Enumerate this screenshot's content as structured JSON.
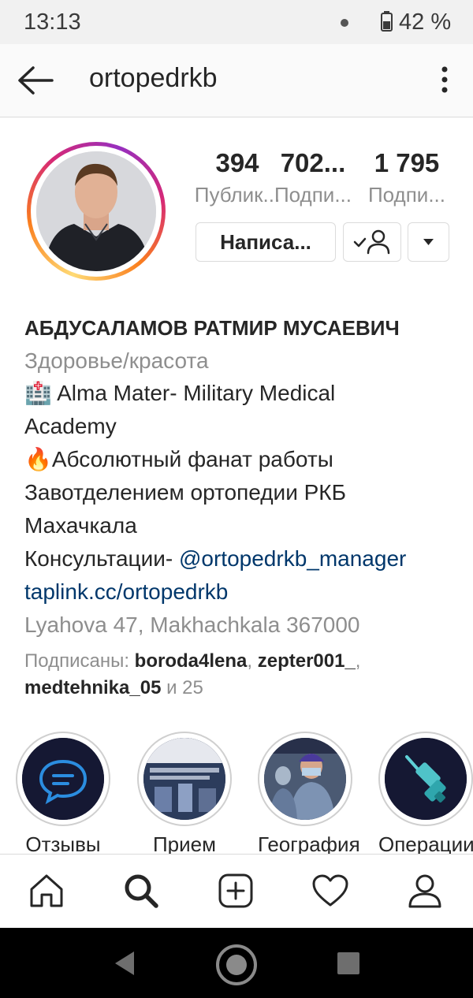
{
  "status_bar": {
    "time": "13:13",
    "battery": "42 %"
  },
  "header": {
    "username": "ortopedrkb",
    "back_icon": "arrow-left-icon",
    "menu_icon": "kebab-menu-icon"
  },
  "stats": [
    {
      "value": "394",
      "label": "Публик..."
    },
    {
      "value": "702...",
      "label": "Подпи..."
    },
    {
      "value": "1 795",
      "label": "Подпи..."
    }
  ],
  "actions": {
    "message_label": "Написа...",
    "follow_icon": "following-check-user-icon",
    "dropdown_icon": "caret-down-icon"
  },
  "bio": {
    "name": "АБДУСАЛАМОВ РАТМИР МУСАЕВИЧ",
    "category": "Здоровье/красота",
    "line1_emoji": "🏥",
    "line1_text": " Alma Mater- Military Medical",
    "line2_text": "Academy",
    "line3_emoji": "🔥",
    "line3_text": "Абсолютный фанат работы",
    "line4_text": "Завотделением ортопедии РКБ",
    "line5_text": "Махачкала",
    "line6_prefix": "Консультации- ",
    "line6_mention": "@ortopedrkb_manager",
    "website": "taplink.cc/ortopedrkb",
    "address": "Lyahova 47, Makhachkala 367000"
  },
  "followed_by": {
    "prefix": "Подписаны: ",
    "user1": "boroda4lena",
    "sep1": ", ",
    "user2": "zepter001_",
    "sep2": ",",
    "user3": "medtehnika_05",
    "suffix": " и 25"
  },
  "highlights": [
    {
      "label": "Отзывы",
      "icon": "chat-bubble-icon"
    },
    {
      "label": "Прием",
      "icon": "clinic-photo"
    },
    {
      "label": "География",
      "icon": "surgeons-photo"
    },
    {
      "label": "Операции",
      "icon": "drill-icon"
    }
  ],
  "bottom_nav": [
    "home-icon",
    "search-icon",
    "add-post-icon",
    "heart-icon",
    "profile-icon"
  ],
  "colors": {
    "link": "#00376b",
    "secondary_text": "#8e8e8e",
    "primary_text": "#262626",
    "story_ring": "#d62976"
  }
}
